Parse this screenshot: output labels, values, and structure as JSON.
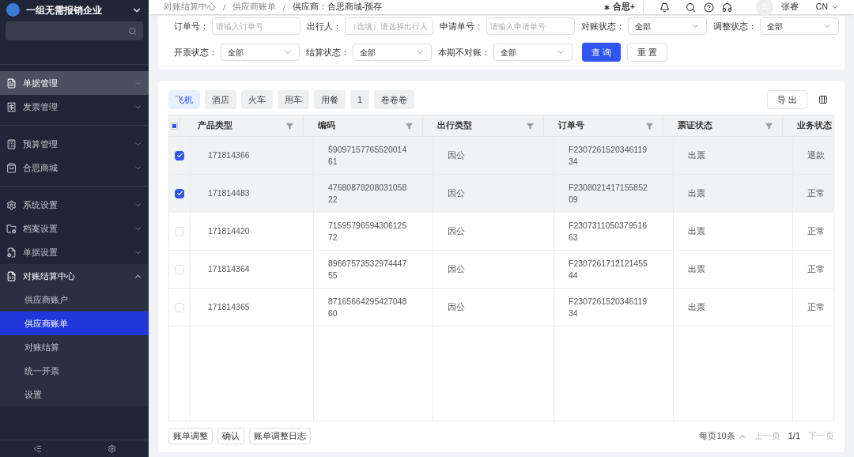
{
  "sidebar": {
    "company": "一组无需报销企业",
    "groups": [
      [
        {
          "label": "单据管理",
          "selected": true,
          "expanded": false
        },
        {
          "label": "发票管理",
          "selected": false,
          "expanded": false
        }
      ],
      [
        {
          "label": "预算管理",
          "selected": false,
          "expanded": false
        },
        {
          "label": "合思商城",
          "selected": false,
          "expanded": false
        }
      ],
      [
        {
          "label": "系统设置",
          "selected": false,
          "expanded": false
        },
        {
          "label": "档案设置",
          "selected": false,
          "expanded": false
        },
        {
          "label": "单据设置",
          "selected": false,
          "expanded": false
        },
        {
          "label": "对账结算中心",
          "selected": false,
          "expanded": true,
          "children": [
            {
              "label": "供应商账户",
              "selected": false
            },
            {
              "label": "供应商账单",
              "selected": true
            },
            {
              "label": "对账结算",
              "selected": false
            },
            {
              "label": "统一开票",
              "selected": false
            },
            {
              "label": "设置",
              "selected": false
            }
          ]
        }
      ]
    ]
  },
  "breadcrumb": [
    "对账结算中心",
    "供应商账单",
    "供应商：合思商城-预存"
  ],
  "header": {
    "brand": "合思+",
    "user": "张睿",
    "language": "CN"
  },
  "filters": [
    [
      {
        "label": "订单号：",
        "placeholder": "请输入订单号",
        "kind": "input"
      },
      {
        "label": "出行人：",
        "placeholder": "（选填）请选择出行人",
        "kind": "input"
      },
      {
        "label": "申请单号：",
        "placeholder": "请输入申请单号",
        "kind": "input"
      },
      {
        "label": "对账状态：",
        "value": "全部",
        "kind": "select"
      },
      {
        "label": "调整状态：",
        "value": "全部",
        "kind": "select"
      }
    ],
    [
      {
        "label": "开票状态：",
        "value": "全部",
        "kind": "select"
      },
      {
        "label": "结算状态：",
        "value": "全部",
        "kind": "select"
      },
      {
        "label": "本期不对账：",
        "value": "全部",
        "kind": "select"
      }
    ]
  ],
  "filter_buttons": {
    "query": "查 询",
    "reset": "重 置"
  },
  "category_tabs": [
    {
      "label": "飞机",
      "selected": true
    },
    {
      "label": "酒店",
      "selected": false
    },
    {
      "label": "火车",
      "selected": false
    },
    {
      "label": "用车",
      "selected": false
    },
    {
      "label": "用餐",
      "selected": false
    },
    {
      "label": "1",
      "selected": false
    },
    {
      "label": "卷卷卷",
      "selected": false
    }
  ],
  "export": "导 出",
  "table": {
    "columns": [
      "产品类型",
      "编码",
      "出行类型",
      "订单号",
      "票证状态",
      "业务状态"
    ],
    "select_all_indeterminate": true,
    "rows": [
      {
        "selected": true,
        "cells": [
          "171814366",
          "5909715776552001461",
          "因公",
          "F230726152034611934",
          "出票",
          "退款"
        ]
      },
      {
        "selected": true,
        "cells": [
          "171814483",
          "4768087820803105822",
          "因公",
          "F230802141715585209",
          "出票",
          "正常"
        ]
      },
      {
        "selected": false,
        "cells": [
          "171814420",
          "7159579659430612572",
          "因公",
          "F230731105037951663",
          "出票",
          "正常"
        ]
      },
      {
        "selected": false,
        "cells": [
          "171814364",
          "8966757353297444755",
          "因公",
          "F230726171212145544",
          "出票",
          "正常"
        ]
      },
      {
        "selected": false,
        "cells": [
          "171814365",
          "8716566429542704860",
          "因公",
          "F230726152034611934",
          "出票",
          "正常"
        ]
      }
    ]
  },
  "actions": [
    "账单调整",
    "确认",
    "账单调整日志"
  ],
  "pagination": {
    "page_size": "每页10条",
    "prev": "上一页",
    "page": "1/1",
    "next": "下一页"
  }
}
